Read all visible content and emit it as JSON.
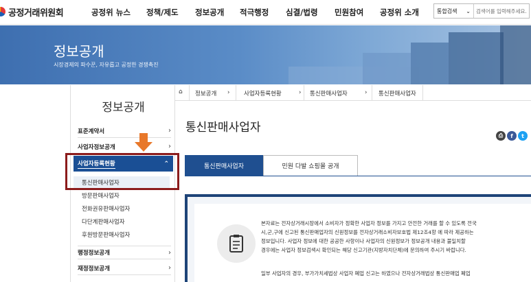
{
  "header": {
    "logo_text": "공정거래위원회",
    "nav": [
      "공정위 뉴스",
      "정책/제도",
      "정보공개",
      "적극행정",
      "심결/법령",
      "민원참여",
      "공정위 소개"
    ],
    "search_scope": "통합검색",
    "search_placeholder": "검색어를 입력해주세요."
  },
  "banner": {
    "title": "정보공개",
    "subtitle": "시장경제의 파수꾼, 자유롭고 공정한 경쟁촉진"
  },
  "sidebar": {
    "title": "정보공개",
    "items": [
      "표준계약서",
      "사업자정보공개"
    ],
    "active": "사업자등록현황",
    "sub_items": [
      "통신판매사업자",
      "방문판매사업자",
      "전화권유판매사업자",
      "다단계판매사업자",
      "후원방문판매사업자"
    ],
    "bottom_items": [
      "행정정보공개",
      "재정정보공개"
    ]
  },
  "breadcrumb": [
    "정보공개",
    "사업자등록현황",
    "통신판매사업자",
    "통신판매사업자"
  ],
  "content": {
    "title": "통신판매사업자",
    "tabs": [
      "통신판매사업자",
      "민원 다발 쇼핑몰 공개"
    ],
    "info_lines": [
      "본자료는 전자상거래시장에서 소비자가 정확한 사업자 정보를 가지고 안전한 거래를 할 수 있도록 전국",
      "시,군,구에 신고된 통신판매업자의 신원정보를 전자상거래소비자보호법 제12조4항 에 따라 제공하는",
      "정보입니다. 사업자 정보에 대한 공공한 사항이나 사업자의 신원정보가 정보공개 내용과 불일치할",
      "경우에는 사업자 정보검색시 확인되는 해당 신고기관(지방자치단체)에 문의하여 주시기 바랍니다."
    ],
    "info_line_extra": "일부 사업자의 경우, 부가가치세법상 사업자 폐업 신고는 하였으나 전자상거래법상 통신판매업 폐업"
  },
  "colors": {
    "primary": "#1a4f95",
    "highlight_box": "#8b1b1b",
    "arrow": "#e8782a"
  },
  "icons": [
    "home-icon",
    "print-icon",
    "facebook-icon",
    "twitter-icon",
    "checklist-icon",
    "down-arrow-icon"
  ]
}
